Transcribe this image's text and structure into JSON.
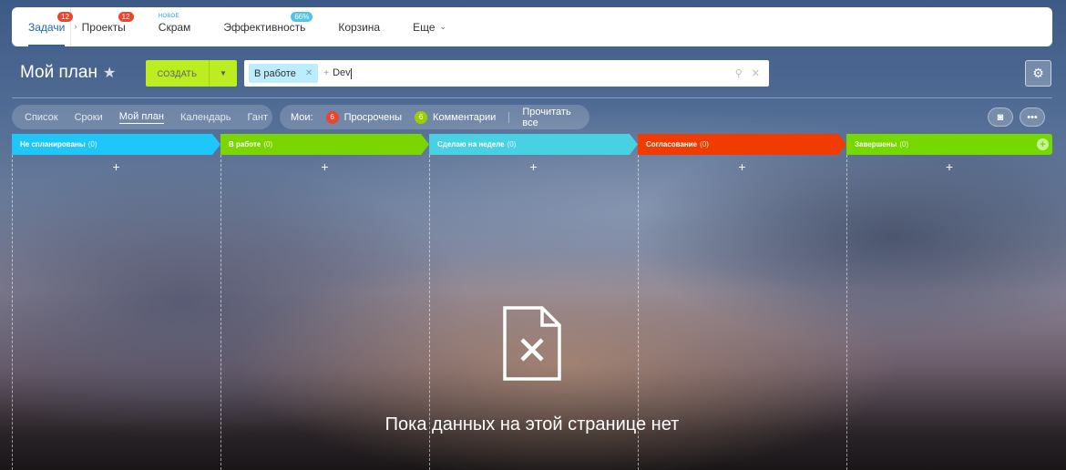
{
  "nav": {
    "items": [
      {
        "label": "Задачи",
        "badge": "12",
        "active": true
      },
      {
        "label": "Проекты",
        "badge": "12"
      },
      {
        "label": "Скрам",
        "tag": "НОВОЕ"
      },
      {
        "label": "Эффективность",
        "badge": "66%"
      },
      {
        "label": "Корзина"
      },
      {
        "label": "Еще",
        "chevron": "chevron-down-icon"
      }
    ]
  },
  "header": {
    "title": "Мой план",
    "create_label": "СОЗДАТЬ",
    "search": {
      "chip": "В работе",
      "value": "Dev"
    }
  },
  "views": {
    "items": [
      "Список",
      "Сроки",
      "Мой план",
      "Календарь",
      "Гант"
    ],
    "active": "Мой план"
  },
  "counters": {
    "label": "Мои:",
    "overdue": {
      "count": "6",
      "label": "Просрочены"
    },
    "comments": {
      "count": "6",
      "label": "Комментарии"
    },
    "read_all": "Прочитать все"
  },
  "columns": [
    {
      "title": "Не спланированы",
      "count": "(0)",
      "color": "#1ec6fa"
    },
    {
      "title": "В работе",
      "count": "(0)",
      "color": "#7bd500"
    },
    {
      "title": "Сделаю на неделе",
      "count": "(0)",
      "color": "#47d1e2"
    },
    {
      "title": "Согласование",
      "count": "(0)",
      "color": "#f23b00"
    },
    {
      "title": "Завершены",
      "count": "(0)",
      "color": "#75d900"
    }
  ],
  "empty_state": {
    "text": "Пока данных на этой странице нет",
    "icon": "file-x-icon"
  },
  "colors": {
    "create": "#bbed21",
    "accent": "#2067b0",
    "badge": "#e8472e"
  }
}
